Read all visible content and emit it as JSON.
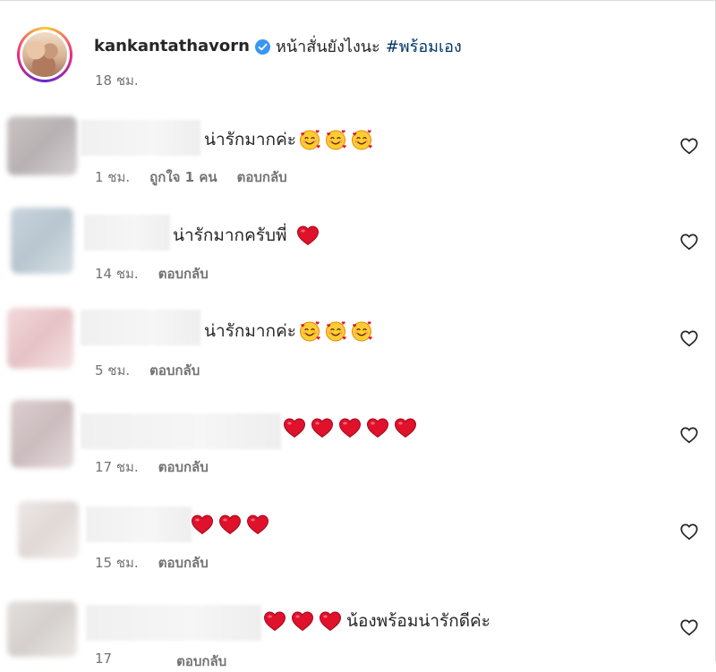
{
  "post": {
    "username": "kankantathavorn",
    "caption": "หน้าสั่นยังไงนะ",
    "hashtag": "#พร้อมเอง",
    "time": "18 ชม."
  },
  "comments": [
    {
      "text": "น่ารักมากค่ะ",
      "emojis": [
        "smiling-face-with-hearts",
        "smiling-face-with-hearts",
        "smiling-face-with-hearts"
      ],
      "time": "1 ชม.",
      "likes": "ถูกใจ 1 คน",
      "reply": "ตอบกลับ"
    },
    {
      "text": "น่ารักมากครับพี่",
      "emojis": [
        "red-heart"
      ],
      "time": "14 ชม.",
      "likes": "",
      "reply": "ตอบกลับ"
    },
    {
      "text": "น่ารักมากค่ะ",
      "emojis": [
        "smiling-face-with-hearts",
        "smiling-face-with-hearts",
        "smiling-face-with-hearts"
      ],
      "time": "5 ชม.",
      "likes": "",
      "reply": "ตอบกลับ"
    },
    {
      "text": "",
      "emojis": [
        "red-heart",
        "red-heart",
        "red-heart",
        "red-heart",
        "red-heart"
      ],
      "time": "17 ชม.",
      "likes": "",
      "reply": "ตอบกลับ"
    },
    {
      "text": "",
      "emojis": [
        "red-heart",
        "red-heart",
        "red-heart"
      ],
      "time": "15 ชม.",
      "likes": "",
      "reply": "ตอบกลับ"
    },
    {
      "text": "น้องพร้อมน่ารักดีค่ะ",
      "emojis": [
        "red-heart",
        "red-heart",
        "red-heart"
      ],
      "time": "17",
      "likes": "",
      "reply": "ตอบกลับ"
    }
  ],
  "colors": {
    "verified": "#3897f0",
    "hashtag": "#00376b",
    "meta": "#737373",
    "heart_emoji": "#e0112b"
  },
  "icons": {
    "verified": "verified-badge-icon",
    "like": "heart-outline-icon",
    "heart_emoji": "red-heart",
    "face_emoji": "smiling-face-with-hearts"
  }
}
